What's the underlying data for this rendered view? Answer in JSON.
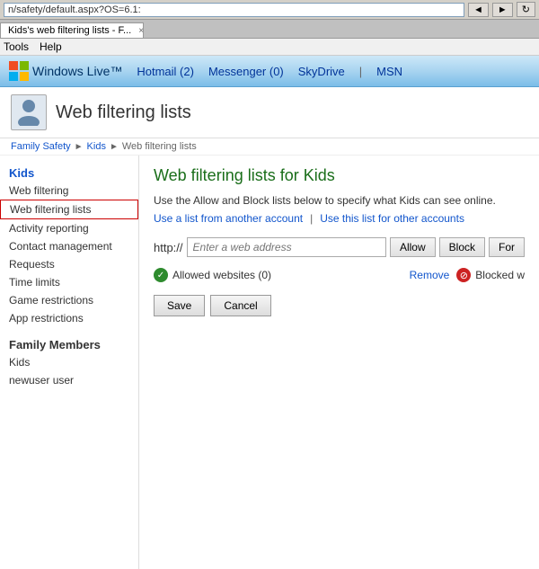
{
  "browser": {
    "address": "n/safety/default.aspx?OS=6.1:",
    "tab1_label": "Kids's web filtering lists - F...",
    "tab1_close": "×",
    "menu_tools": "Tools",
    "menu_help": "Help"
  },
  "wl_header": {
    "logo": "Windows Live™",
    "hotmail": "Hotmail (2)",
    "messenger": "Messenger (0)",
    "skydrive": "SkyDrive",
    "sep1": "|",
    "msn": "MSN"
  },
  "page": {
    "title": "Web filtering lists",
    "icon_label": "family-safety-icon",
    "breadcrumb": {
      "root": "Family Safety",
      "child": "Kids",
      "current": "Web filtering lists"
    }
  },
  "sidebar": {
    "section_title": "Kids",
    "items": [
      {
        "label": "Web filtering",
        "selected": false
      },
      {
        "label": "Web filtering lists",
        "selected": true
      },
      {
        "label": "Activity reporting",
        "selected": false
      },
      {
        "label": "Contact management",
        "selected": false
      },
      {
        "label": "Requests",
        "selected": false
      },
      {
        "label": "Time limits",
        "selected": false
      },
      {
        "label": "Game restrictions",
        "selected": false
      },
      {
        "label": "App restrictions",
        "selected": false
      }
    ],
    "family_section": "Family Members",
    "family_items": [
      {
        "label": "Kids"
      },
      {
        "label": "newuser user"
      }
    ]
  },
  "content": {
    "title": "Web filtering lists for Kids",
    "description": "Use the Allow and Block lists below to specify what Kids can see online.",
    "link_another": "Use a list from another account",
    "link_sep": "|",
    "link_other": "Use this list for other accounts",
    "url_prefix": "http://",
    "url_placeholder": "Enter a web address",
    "btn_allow": "Allow",
    "btn_block": "Block",
    "btn_for": "For",
    "allowed_label": "Allowed websites (0)",
    "remove_label": "Remove",
    "blocked_label": "Blocked w",
    "btn_save": "Save",
    "btn_cancel": "Cancel"
  }
}
